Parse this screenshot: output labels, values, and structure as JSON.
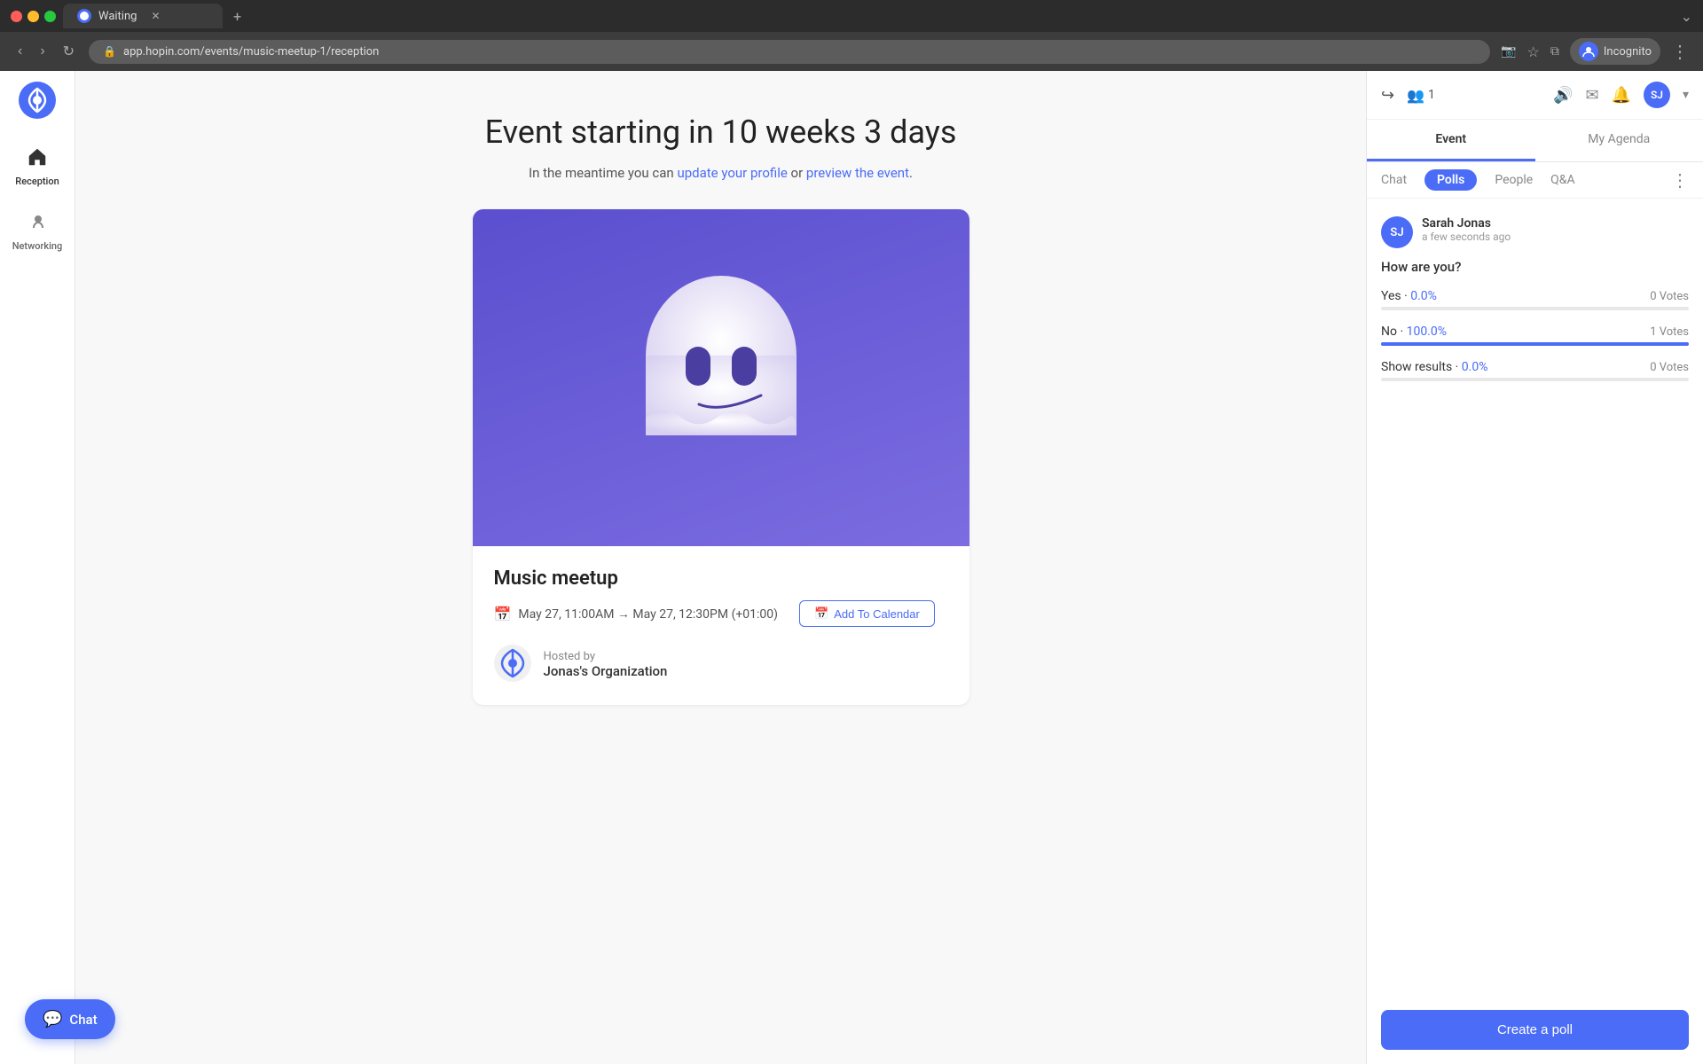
{
  "browser": {
    "tab_title": "Waiting",
    "url": "app.hopin.com/events/music-meetup-1/reception",
    "user": "Incognito"
  },
  "sidebar": {
    "logo_alt": "Hopin logo",
    "items": [
      {
        "id": "reception",
        "label": "Reception",
        "icon": "🏠",
        "active": true
      },
      {
        "id": "networking",
        "label": "Networking",
        "icon": "🤝",
        "active": false
      }
    ]
  },
  "main": {
    "countdown": "Event starting in 10 weeks 3 days",
    "subtitle_start": "In the meantime you can ",
    "update_profile_link": "update your profile",
    "conjunction": " or ",
    "preview_event_link": "preview the event",
    "subtitle_end": ".",
    "event": {
      "name": "Music meetup",
      "date_range": "May 27, 11:00AM → May 27, 12:30PM (+01:00)",
      "add_calendar_label": "Add To Calendar",
      "hosted_by": "Hosted by",
      "org_name": "Jonas's Organization"
    }
  },
  "right_panel": {
    "attendee_count": "1",
    "tabs": [
      {
        "id": "event",
        "label": "Event",
        "active": true
      },
      {
        "id": "my_agenda",
        "label": "My Agenda",
        "active": false
      }
    ],
    "sub_tabs": [
      {
        "id": "chat",
        "label": "Chat",
        "active": false
      },
      {
        "id": "polls",
        "label": "Polls",
        "active": true
      },
      {
        "id": "people",
        "label": "People",
        "active": false
      },
      {
        "id": "qa",
        "label": "Q&A",
        "active": false
      }
    ],
    "poll": {
      "author_initials": "SJ",
      "author_name": "Sarah Jonas",
      "author_time": "a few seconds ago",
      "question": "How are you?",
      "options": [
        {
          "label": "Yes",
          "pct": "0.0%",
          "votes_label": "0 Votes",
          "fill_width": 0
        },
        {
          "label": "No",
          "pct": "100.0%",
          "votes_label": "1 Votes",
          "fill_width": 100
        },
        {
          "label": "Show results",
          "pct": "0.0%",
          "votes_label": "0 Votes",
          "fill_width": 0
        }
      ]
    },
    "create_poll_label": "Create a poll"
  },
  "chat_button": {
    "label": "Chat",
    "icon": "💬"
  },
  "user_avatar": {
    "initials": "SJ",
    "bg_color": "#4a6cf7"
  }
}
